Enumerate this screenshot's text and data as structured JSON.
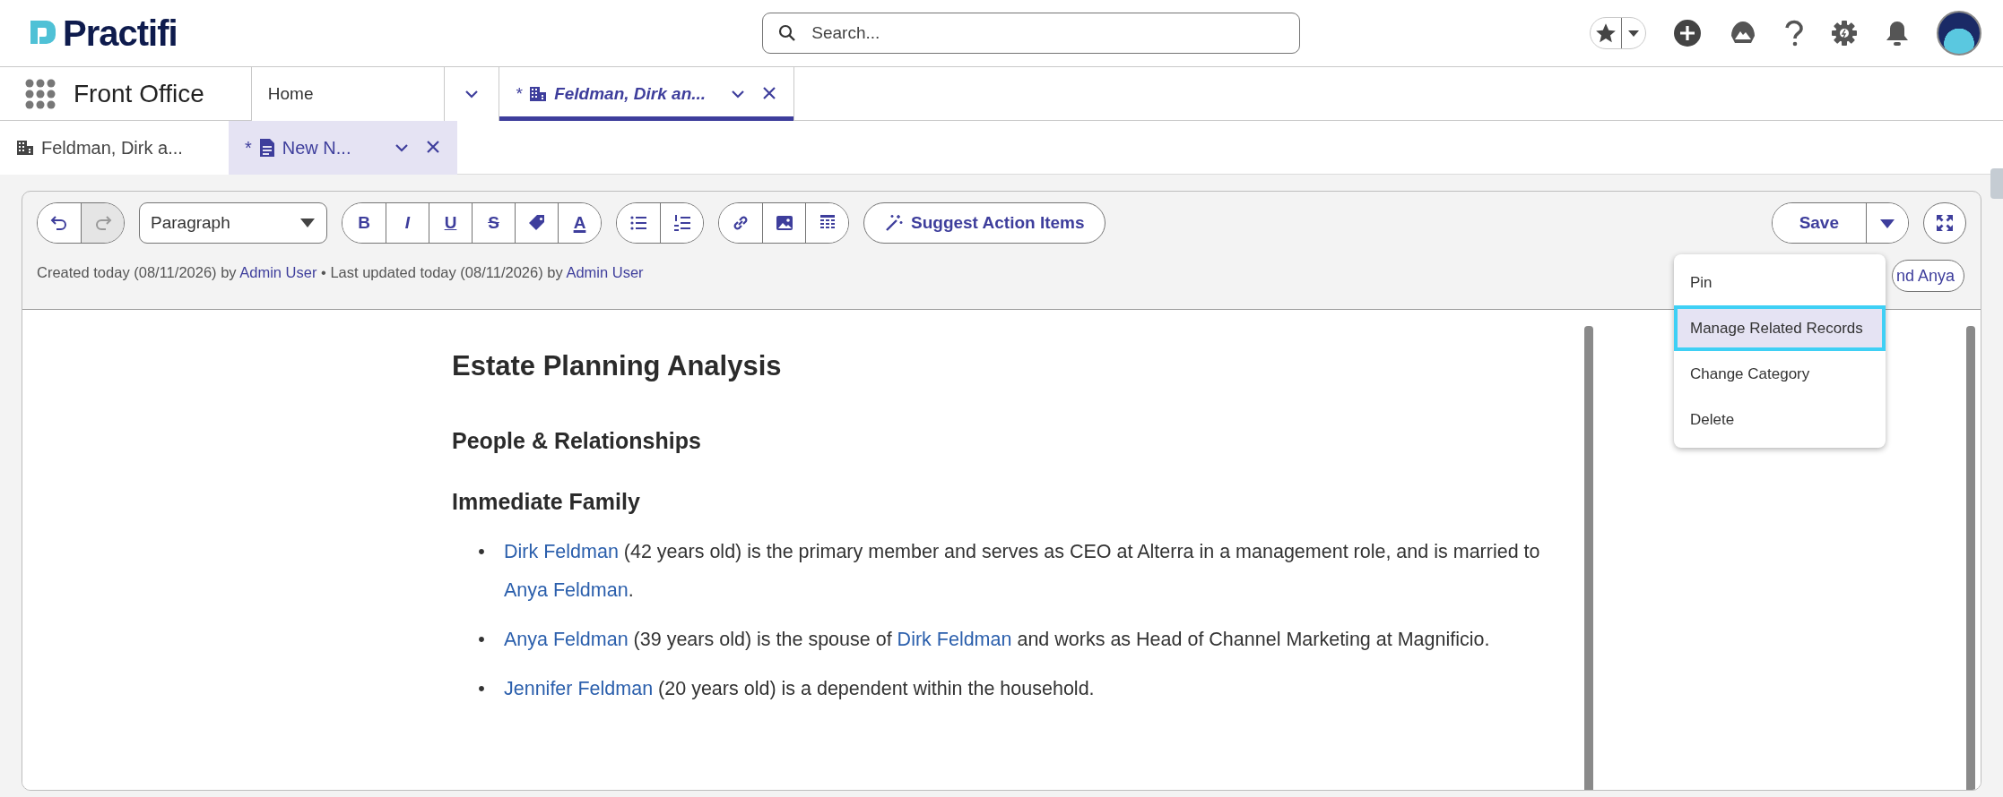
{
  "header": {
    "logo": "Practifi",
    "search": {
      "placeholder": "Search..."
    }
  },
  "nav": {
    "app_name": "Front Office",
    "tabs": [
      {
        "label": "Home",
        "selected": false,
        "closable": false
      },
      {
        "unsaved_mark": "*",
        "label": "Feldman, Dirk an...",
        "selected": true,
        "closable": true
      }
    ]
  },
  "subtabs": [
    {
      "label": "Feldman, Dirk a...",
      "selected": false,
      "closable": false
    },
    {
      "unsaved_mark": "*",
      "label": "New N...",
      "selected": true,
      "closable": true
    }
  ],
  "editor": {
    "toolbar": {
      "history": [
        {
          "disabled": false
        },
        {
          "disabled": true
        }
      ],
      "block_style": "Paragraph",
      "format_labels": [
        "B",
        "I",
        "U",
        "S",
        "A"
      ],
      "suggest_button": "Suggest Action Items",
      "save_button": "Save"
    },
    "meta": [
      {
        "kind": "text",
        "text": "Created today (08/11/2026) by "
      },
      {
        "kind": "link",
        "text": "Admin User"
      },
      {
        "kind": "text",
        "text": " • Last updated today (08/11/2026) by "
      },
      {
        "kind": "link",
        "text": "Admin User"
      }
    ],
    "related_chip": "nd Anya",
    "menu": [
      {
        "label": "Pin",
        "selected": false
      },
      {
        "label": "Manage Related Records",
        "selected": true
      },
      {
        "label": "Change Category",
        "selected": false
      },
      {
        "label": "Delete",
        "selected": false
      }
    ],
    "document": {
      "title": "Estate Planning Analysis",
      "blocks": [
        {
          "kind": "h2",
          "text": "People & Relationships"
        },
        {
          "kind": "h3",
          "text": "Immediate Family"
        },
        {
          "kind": "list",
          "items": [
            {
              "marker": "•",
              "segments": [
                {
                  "kind": "link",
                  "text": "Dirk Feldman"
                },
                {
                  "kind": "text",
                  "text": " (42 years old) is the primary member and serves as CEO at Alterra in a management role, and is married to "
                },
                {
                  "kind": "link",
                  "text": "Anya Feldman"
                },
                {
                  "kind": "text",
                  "text": "."
                }
              ]
            },
            {
              "marker": "•",
              "segments": [
                {
                  "kind": "link",
                  "text": "Anya Feldman"
                },
                {
                  "kind": "text",
                  "text": " (39 years old) is the spouse of "
                },
                {
                  "kind": "link",
                  "text": "Dirk Feldman"
                },
                {
                  "kind": "text",
                  "text": " and works as Head of Channel Marketing at Magnificio."
                }
              ]
            },
            {
              "marker": "•",
              "segments": [
                {
                  "kind": "link",
                  "text": "Jennifer Feldman"
                },
                {
                  "kind": "text",
                  "text": " (20 years old) is a dependent within the household."
                }
              ]
            }
          ]
        }
      ]
    }
  }
}
